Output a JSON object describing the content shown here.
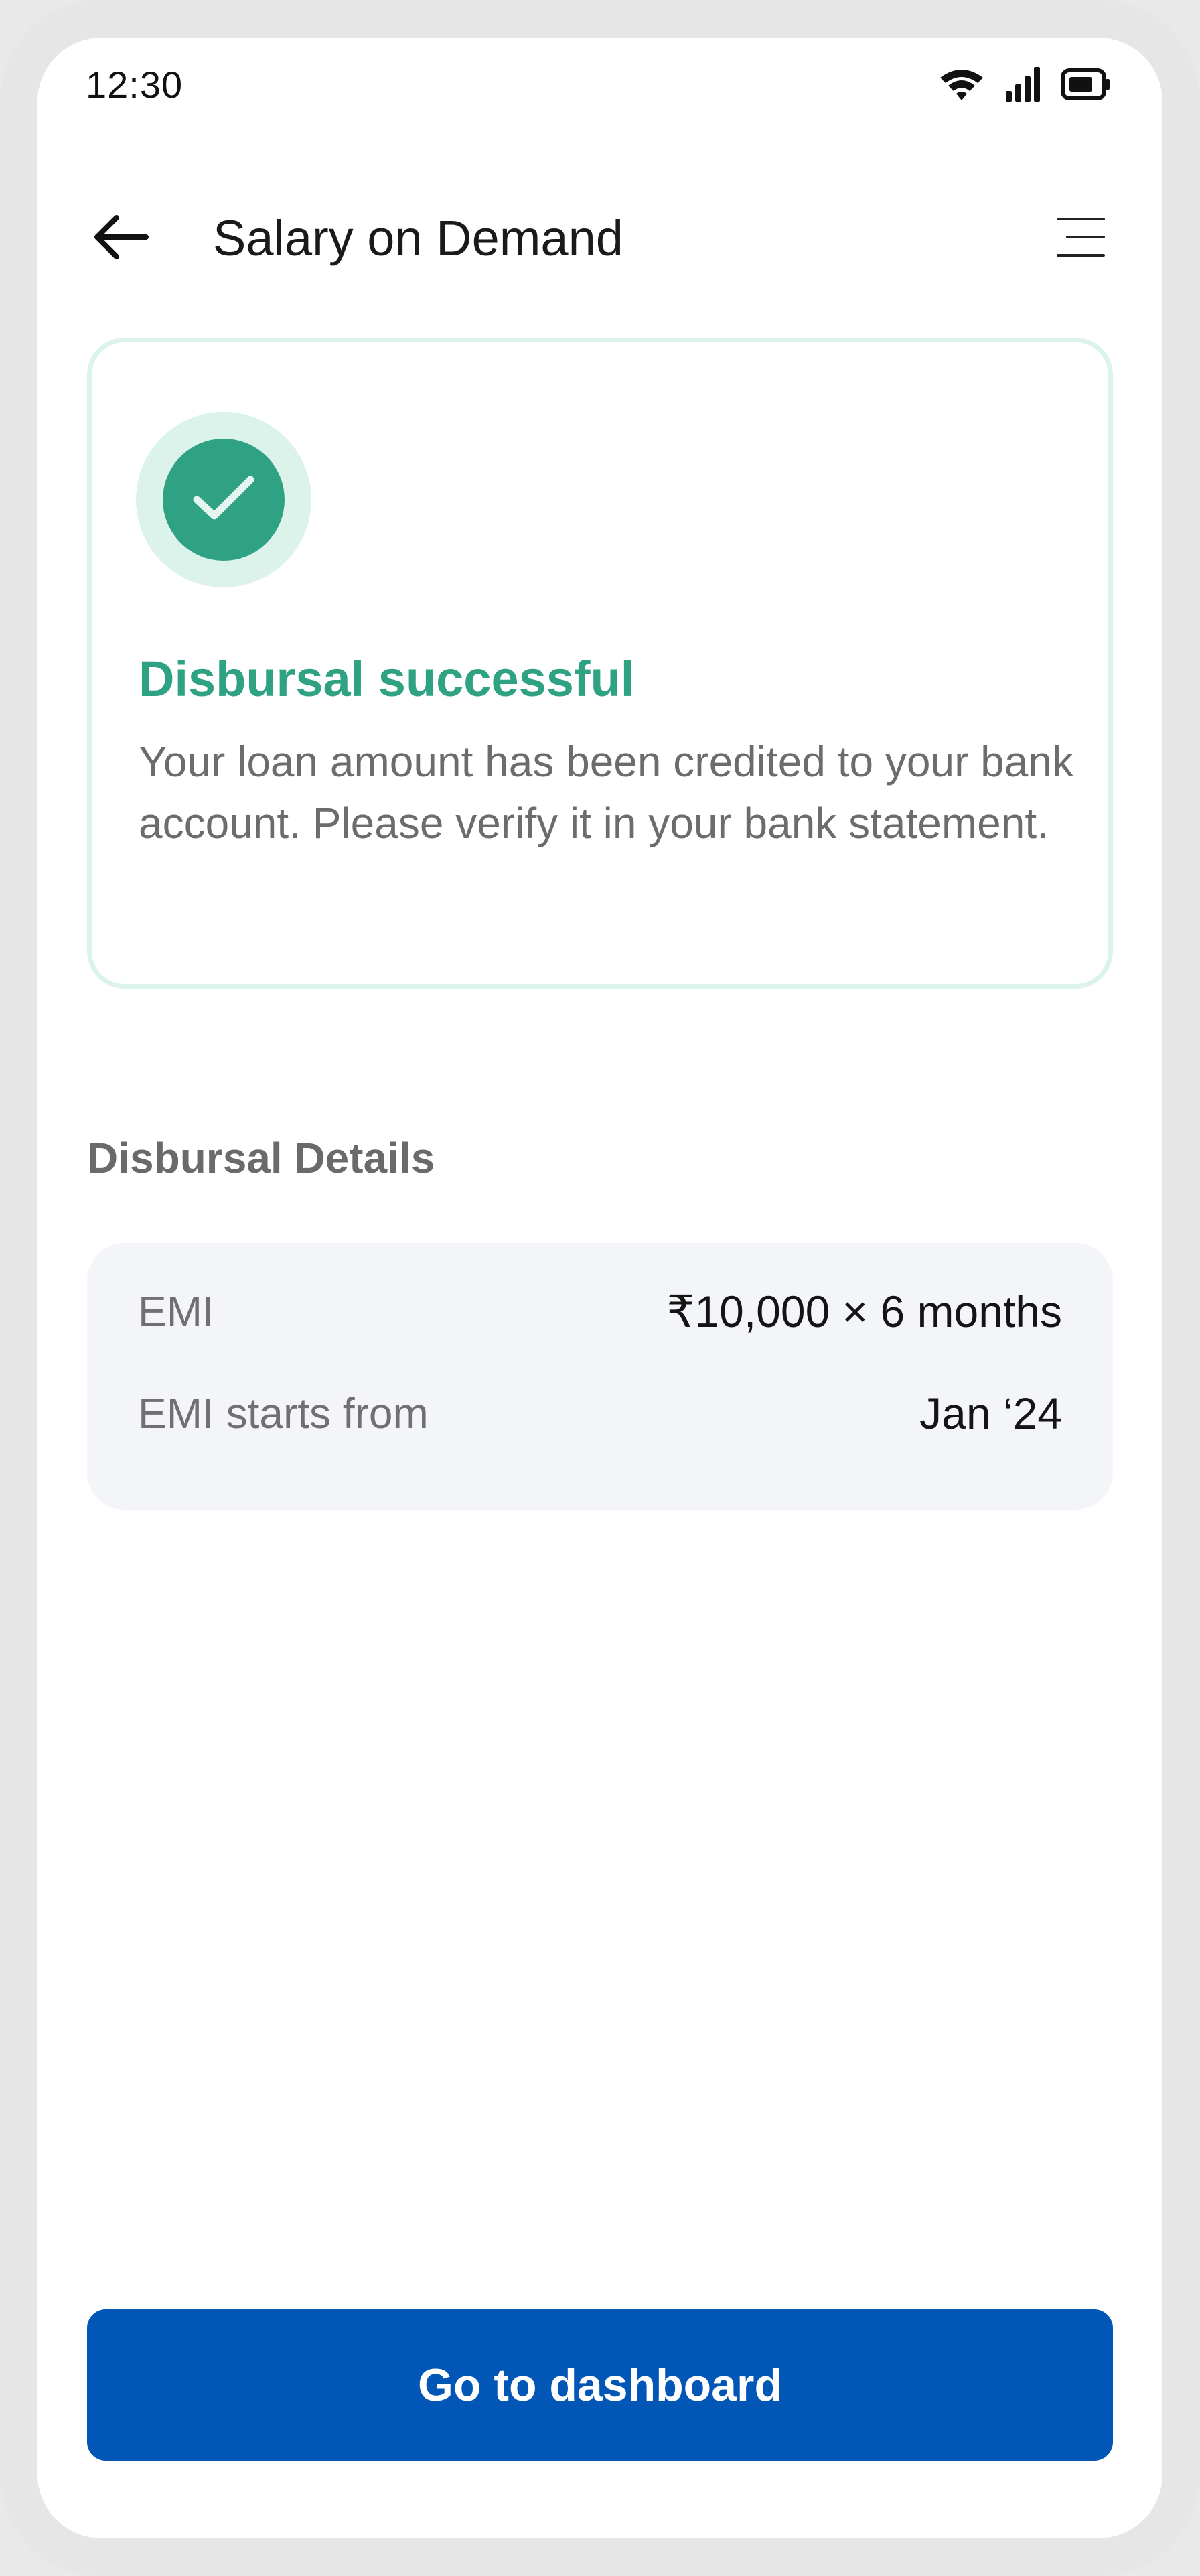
{
  "status_bar": {
    "time": "12:30",
    "icons": [
      "wifi-icon",
      "signal-icon",
      "battery-icon"
    ]
  },
  "app_bar": {
    "title": "Salary on Demand",
    "back_icon": "arrow-left-icon",
    "menu_icon": "menu-icon"
  },
  "success": {
    "icon": "check-icon",
    "title": "Disbursal successful",
    "message": "Your loan amount has been credited to your bank account. Please verify it in your bank statement."
  },
  "details": {
    "heading": "Disbursal Details",
    "rows": [
      {
        "label": "EMI",
        "value": "₹10,000 × 6 months"
      },
      {
        "label": "EMI starts from",
        "value": "Jan ‘24"
      }
    ]
  },
  "cta": {
    "label": "Go to dashboard"
  },
  "colors": {
    "accent_green": "#2ea283",
    "light_green": "#dcf3ec",
    "primary_blue": "#0256b5",
    "card_grey": "#f4f5f9"
  }
}
